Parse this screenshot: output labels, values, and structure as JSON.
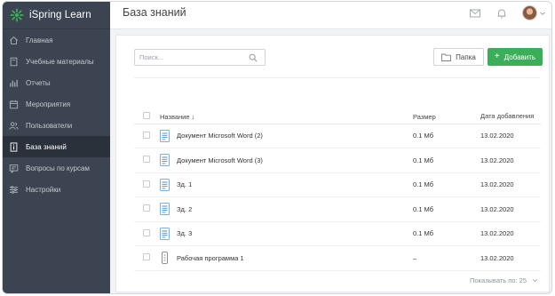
{
  "app": {
    "name": "iSpring Learn",
    "brand_color": "#3cae5a"
  },
  "page": {
    "title": "База знаний"
  },
  "sidebar": {
    "items": [
      {
        "label": "Главная",
        "icon": "home-icon",
        "active": false
      },
      {
        "label": "Учебные материалы",
        "icon": "book-icon",
        "active": false
      },
      {
        "label": "Отчеты",
        "icon": "chart-icon",
        "active": false
      },
      {
        "label": "Мероприятия",
        "icon": "calendar-icon",
        "active": false
      },
      {
        "label": "Пользователи",
        "icon": "users-icon",
        "active": false
      },
      {
        "label": "База знаний",
        "icon": "info-icon",
        "active": true
      },
      {
        "label": "Вопросы по курсам",
        "icon": "chat-icon",
        "active": false
      },
      {
        "label": "Настройки",
        "icon": "sliders-icon",
        "active": false
      }
    ]
  },
  "toolbar": {
    "search_placeholder": "Поиск...",
    "folder_label": "Папка",
    "add_label": "Добавить"
  },
  "table": {
    "headers": {
      "name": "Название",
      "sort": "↓",
      "size": "Размер",
      "date": "Дата добавления"
    },
    "rows": [
      {
        "name": "Документ Microsoft Word (2)",
        "size": "0.1 Мб",
        "date": "13.02.2020",
        "icon": "document-icon"
      },
      {
        "name": "Документ Microsoft Word (3)",
        "size": "0.1 Мб",
        "date": "13.02.2020",
        "icon": "document-icon"
      },
      {
        "name": "Зд. 1",
        "size": "0.1 Мб",
        "date": "13.02.2020",
        "icon": "document-icon"
      },
      {
        "name": "Зд. 2",
        "size": "0.1 Мб",
        "date": "13.02.2020",
        "icon": "document-icon"
      },
      {
        "name": "Зд. 3",
        "size": "0.1 Мб",
        "date": "13.02.2020",
        "icon": "document-icon"
      },
      {
        "name": "Рабочая программа 1",
        "size": "–",
        "date": "13.02.2020",
        "icon": "program-icon"
      }
    ]
  },
  "pagination": {
    "label": "Показывать по: 25"
  }
}
